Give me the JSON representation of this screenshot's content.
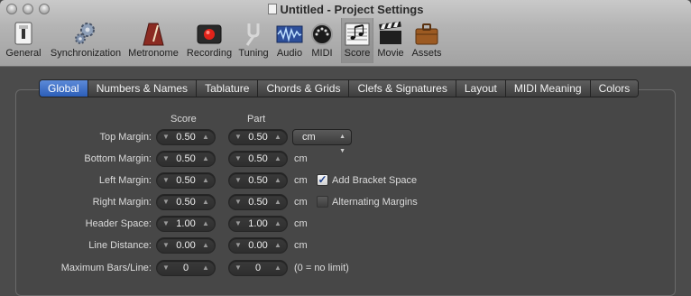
{
  "window": {
    "title": "Untitled - Project Settings"
  },
  "toolbar": {
    "items": [
      {
        "label": "General",
        "icon": "general-icon"
      },
      {
        "label": "Synchronization",
        "icon": "gears-icon"
      },
      {
        "label": "Metronome",
        "icon": "metronome-icon"
      },
      {
        "label": "Recording",
        "icon": "record-icon"
      },
      {
        "label": "Tuning",
        "icon": "tuning-fork-icon"
      },
      {
        "label": "Audio",
        "icon": "audio-waveform-icon"
      },
      {
        "label": "MIDI",
        "icon": "midi-port-icon"
      },
      {
        "label": "Score",
        "icon": "score-notes-icon"
      },
      {
        "label": "Movie",
        "icon": "clapperboard-icon"
      },
      {
        "label": "Assets",
        "icon": "briefcase-icon"
      }
    ],
    "active": "Score"
  },
  "tabs": [
    "Global",
    "Numbers & Names",
    "Tablature",
    "Chords & Grids",
    "Clefs & Signatures",
    "Layout",
    "MIDI Meaning",
    "Colors"
  ],
  "selected_tab": "Global",
  "columns": {
    "score": "Score",
    "part": "Part"
  },
  "rows": [
    {
      "label": "Top Margin:",
      "score": "0.50",
      "part": "0.50"
    },
    {
      "label": "Bottom Margin:",
      "score": "0.50",
      "part": "0.50",
      "unit": "cm"
    },
    {
      "label": "Left Margin:",
      "score": "0.50",
      "part": "0.50",
      "unit": "cm"
    },
    {
      "label": "Right Margin:",
      "score": "0.50",
      "part": "0.50",
      "unit": "cm"
    },
    {
      "label": "Header Space:",
      "score": "1.00",
      "part": "1.00",
      "unit": "cm"
    },
    {
      "label": "Line Distance:",
      "score": "0.00",
      "part": "0.00",
      "unit": "cm"
    },
    {
      "label": "Maximum Bars/Line:",
      "score": "0",
      "part": "0",
      "unit": "(0 = no limit)"
    }
  ],
  "unit_select": {
    "value": "cm"
  },
  "options": {
    "add_bracket_space": {
      "label": "Add Bracket Space",
      "checked": true
    },
    "alternating_margins": {
      "label": "Alternating Margins",
      "checked": false
    }
  },
  "colors": {
    "selected_tab": "#2c5eb8",
    "checkmark": "#1d3f8a"
  }
}
